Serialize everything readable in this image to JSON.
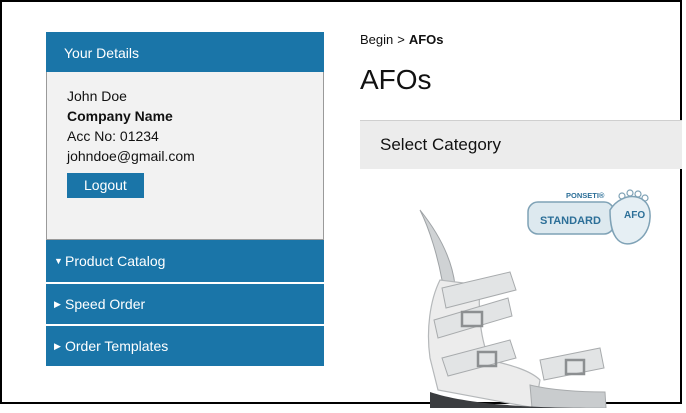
{
  "sidebar": {
    "details": {
      "header": "Your Details",
      "name": "John Doe",
      "company": "Company Name",
      "account": "Acc No: 01234",
      "email": "johndoe@gmail.com",
      "logout_label": "Logout"
    },
    "nav": [
      {
        "label": "Product Catalog",
        "caret": "▼",
        "expanded": true
      },
      {
        "label": "Speed Order",
        "caret": "▶",
        "expanded": false
      },
      {
        "label": "Order Templates",
        "caret": "▶",
        "expanded": false
      }
    ]
  },
  "breadcrumb": {
    "root": "Begin",
    "separator": ">",
    "current": "AFOs"
  },
  "page_title": "AFOs",
  "category_select": {
    "label": "Select Category"
  },
  "product_badge": {
    "brand": "PONSETI®",
    "model": "STANDARD",
    "type": "AFO"
  },
  "colors": {
    "accent": "#1a75a8",
    "details_bg": "#f2f2f2",
    "category_bg": "#ececec"
  }
}
